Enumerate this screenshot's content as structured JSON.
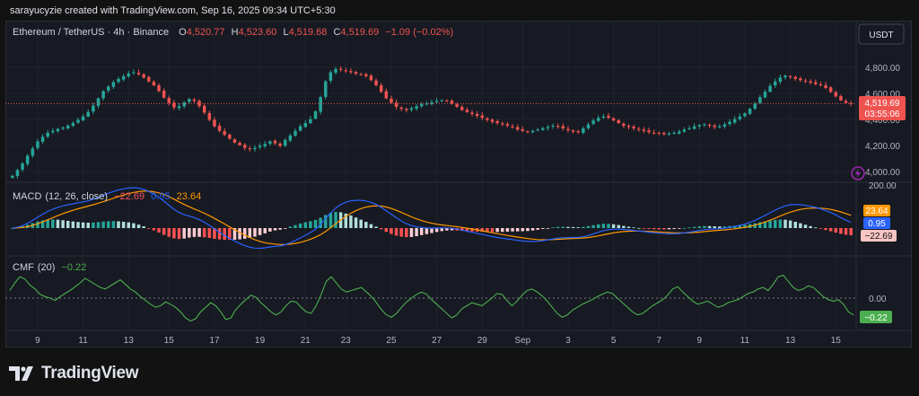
{
  "attribution": "sarayucyzie created with TradingView.com, Sep 16, 2025 09:34 UTC+5:30",
  "brand": "TradingView",
  "colors": {
    "up": "#26a69a",
    "down": "#ef5350",
    "macd": "#2962ff",
    "signal": "#ff9800",
    "cmf": "#4caf50",
    "bg": "#171a22"
  },
  "chart_data": [
    {
      "type": "candlestick",
      "symbol": "Ethereum / TetherUS",
      "interval": "4h",
      "exchange": "Binance",
      "ohlc": {
        "o": "O",
        "o_val": "4,520.77",
        "h": "H",
        "h_val": "4,523.60",
        "l": "L",
        "l_val": "4,519.68",
        "c": "C",
        "c_val": "4,519.69",
        "change": "−1.09 (−0.02%)"
      },
      "currency": "USDT",
      "last_price": "4,519.69",
      "countdown": "03:55:06",
      "yticks": [
        "4,800.00",
        "4,600.00",
        "4,400.00",
        "4,200.00",
        "4,000.00"
      ],
      "ylim": [
        3950,
        4950
      ],
      "xticks": [
        "9",
        "11",
        "13",
        "15",
        "17",
        "19",
        "21",
        "23",
        "25",
        "27",
        "29",
        "Sep",
        "3",
        "5",
        "7",
        "9",
        "11",
        "13",
        "15"
      ],
      "closes": [
        3965,
        4010,
        4060,
        4120,
        4175,
        4230,
        4265,
        4295,
        4310,
        4325,
        4335,
        4350,
        4370,
        4395,
        4420,
        4455,
        4505,
        4560,
        4615,
        4650,
        4685,
        4710,
        4730,
        4750,
        4760,
        4745,
        4720,
        4690,
        4660,
        4615,
        4565,
        4525,
        4490,
        4500,
        4530,
        4555,
        4540,
        4500,
        4450,
        4395,
        4345,
        4310,
        4280,
        4250,
        4220,
        4200,
        4180,
        4170,
        4180,
        4195,
        4210,
        4230,
        4215,
        4195,
        4240,
        4275,
        4310,
        4345,
        4370,
        4400,
        4460,
        4570,
        4690,
        4760,
        4785,
        4780,
        4770,
        4760,
        4750,
        4745,
        4730,
        4700,
        4660,
        4610,
        4560,
        4525,
        4495,
        4480,
        4470,
        4485,
        4500,
        4515,
        4520,
        4530,
        4540,
        4545,
        4540,
        4520,
        4495,
        4470,
        4455,
        4440,
        4425,
        4410,
        4395,
        4380,
        4370,
        4360,
        4350,
        4340,
        4320,
        4310,
        4300,
        4310,
        4320,
        4330,
        4340,
        4350,
        4345,
        4330,
        4315,
        4305,
        4300,
        4330,
        4360,
        4390,
        4410,
        4420,
        4410,
        4390,
        4370,
        4350,
        4340,
        4330,
        4320,
        4310,
        4300,
        4295,
        4290,
        4285,
        4290,
        4295,
        4305,
        4320,
        4330,
        4345,
        4355,
        4360,
        4350,
        4340,
        4345,
        4360,
        4380,
        4400,
        4420,
        4445,
        4480,
        4520,
        4570,
        4610,
        4655,
        4690,
        4720,
        4735,
        4725,
        4710,
        4700,
        4690,
        4680,
        4670,
        4660,
        4640,
        4610,
        4575,
        4545,
        4525,
        4520
      ],
      "panel": "price"
    },
    {
      "type": "line",
      "title": "MACD",
      "params": "(12, 26, close)",
      "values_text": {
        "histogram": "−22.69",
        "macd": "0.95",
        "signal": "23.64"
      },
      "ytick": "200.00",
      "badges": [
        "23.64",
        "0.95",
        "−22.69"
      ],
      "series": [
        {
          "name": "macd"
        },
        {
          "name": "signal"
        },
        {
          "name": "histogram"
        }
      ],
      "panel": "macd"
    },
    {
      "type": "line",
      "title": "CMF",
      "params": "(20)",
      "value_text": "−0.22",
      "ytick": "0.00",
      "badge": "−0.22",
      "ylim": [
        -0.4,
        0.4
      ],
      "values": [
        0.1,
        0.2,
        0.28,
        0.25,
        0.17,
        0.12,
        0.05,
        0.02,
        0.0,
        -0.03,
        0.02,
        0.06,
        0.1,
        0.15,
        0.2,
        0.26,
        0.22,
        0.18,
        0.14,
        0.12,
        0.16,
        0.2,
        0.24,
        0.18,
        0.12,
        0.08,
        0.02,
        -0.03,
        -0.08,
        -0.12,
        -0.1,
        -0.05,
        -0.08,
        -0.12,
        -0.18,
        -0.26,
        -0.3,
        -0.27,
        -0.18,
        -0.12,
        -0.06,
        -0.1,
        -0.18,
        -0.28,
        -0.26,
        -0.15,
        -0.08,
        -0.02,
        0.04,
        0.01,
        -0.06,
        -0.12,
        -0.18,
        -0.22,
        -0.18,
        -0.1,
        -0.04,
        -0.05,
        -0.12,
        -0.18,
        -0.2,
        -0.1,
        0.05,
        0.22,
        0.28,
        0.2,
        0.12,
        0.08,
        0.1,
        0.12,
        0.14,
        0.08,
        0.02,
        -0.06,
        -0.15,
        -0.22,
        -0.25,
        -0.2,
        -0.12,
        -0.05,
        0.0,
        0.05,
        0.08,
        0.05,
        -0.02,
        -0.08,
        -0.14,
        -0.2,
        -0.26,
        -0.22,
        -0.14,
        -0.1,
        -0.06,
        -0.08,
        -0.1,
        -0.05,
        0.0,
        0.06,
        0.05,
        -0.03,
        -0.1,
        -0.04,
        0.04,
        0.1,
        0.12,
        0.08,
        0.03,
        -0.04,
        -0.12,
        -0.2,
        -0.25,
        -0.22,
        -0.16,
        -0.12,
        -0.08,
        -0.05,
        -0.02,
        0.02,
        0.05,
        0.08,
        0.06,
        0.0,
        -0.06,
        -0.12,
        -0.18,
        -0.22,
        -0.2,
        -0.15,
        -0.1,
        -0.06,
        -0.02,
        0.04,
        0.12,
        0.15,
        0.08,
        0.02,
        -0.04,
        -0.08,
        -0.06,
        -0.04,
        -0.08,
        -0.12,
        -0.1,
        -0.06,
        -0.04,
        -0.02,
        0.02,
        0.06,
        0.08,
        0.12,
        0.14,
        0.1,
        0.18,
        0.28,
        0.3,
        0.22,
        0.14,
        0.1,
        0.12,
        0.16,
        0.14,
        0.08,
        0.02,
        -0.02,
        -0.04,
        -0.02,
        -0.08,
        -0.18,
        -0.22
      ],
      "panel": "cmf"
    }
  ]
}
